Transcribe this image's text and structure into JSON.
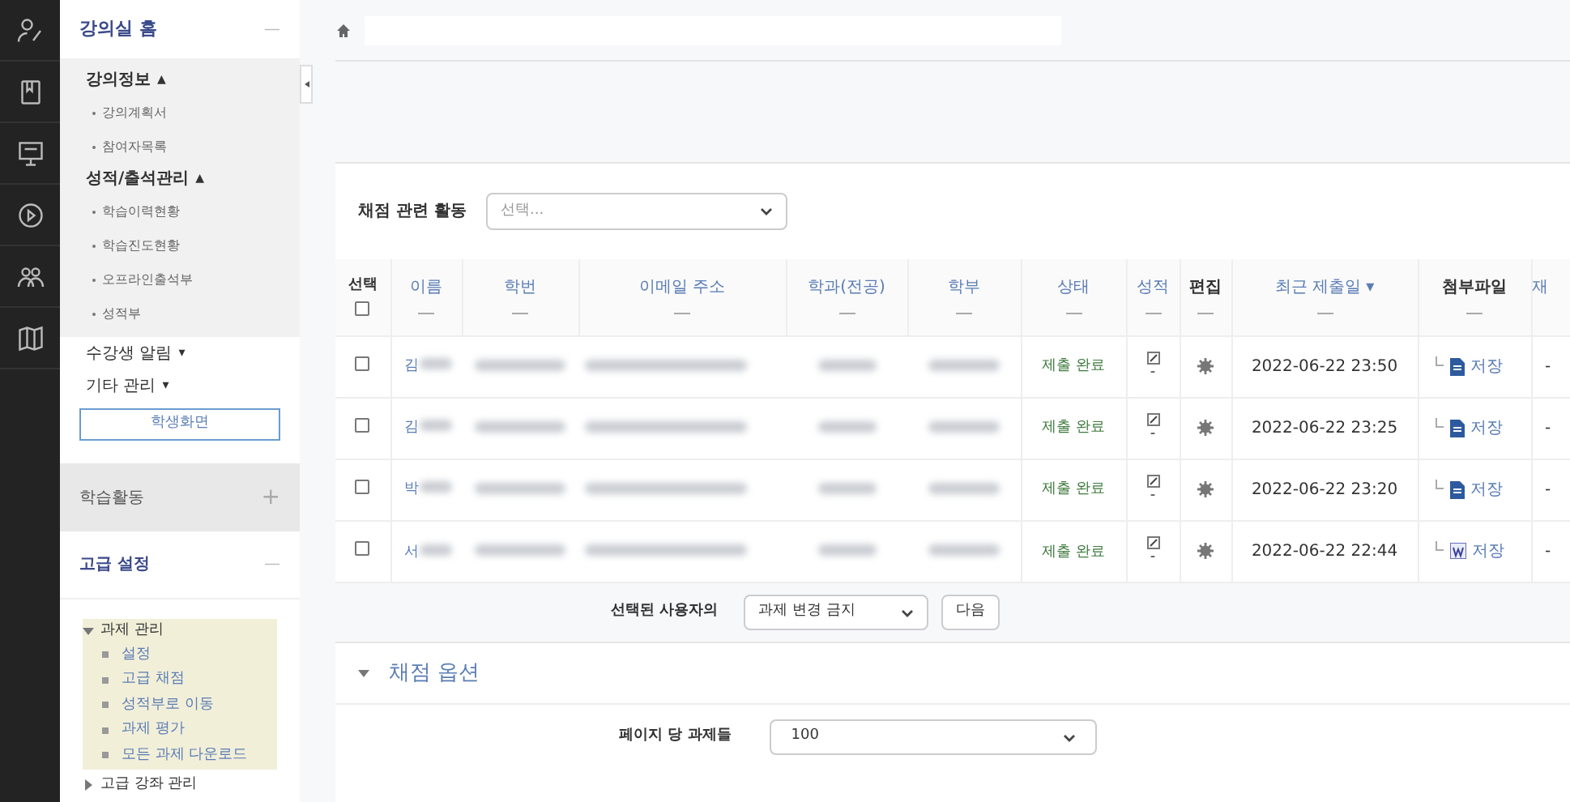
{
  "rail": {
    "items": [
      {
        "kind": "person"
      },
      {
        "kind": "book"
      },
      {
        "kind": "board"
      },
      {
        "kind": "play"
      },
      {
        "kind": "people"
      },
      {
        "kind": "map"
      }
    ]
  },
  "sidebar": {
    "home": {
      "title": "강의실 홈",
      "toggle": "—"
    },
    "groups": [
      {
        "title": "강의정보",
        "arrow": "▲",
        "children": [
          {
            "label": "강의계획서"
          },
          {
            "label": "참여자목록"
          }
        ]
      },
      {
        "title": "성적/출석관리",
        "arrow": "▲",
        "children": [
          {
            "label": "학습이력현황"
          },
          {
            "label": "학습진도현황"
          },
          {
            "label": "오프라인출석부"
          },
          {
            "label": "성적부"
          }
        ]
      }
    ],
    "menus": [
      {
        "label": "수강생 알림",
        "arrow": "▾"
      },
      {
        "label": "기타 관리",
        "arrow": "▾"
      }
    ],
    "student_view_button": "학생화면",
    "activities": {
      "title": "학습활동",
      "toggle": "+"
    },
    "advanced": {
      "title": "고급 설정",
      "toggle": "—"
    },
    "tree": [
      {
        "label": "과제 관리",
        "expanded": true,
        "children": [
          {
            "label": "설정"
          },
          {
            "label": "고급 채점"
          },
          {
            "label": "성적부로 이동"
          },
          {
            "label": "과제 평가"
          },
          {
            "label": "모든 과제 다운로드"
          }
        ]
      },
      {
        "label": "고급 강좌 관리",
        "expanded": false
      }
    ]
  },
  "main": {
    "grading_activity": {
      "label": "채점 관련 활동",
      "placeholder": "선택..."
    },
    "table": {
      "select_all_checked": false,
      "columns": [
        {
          "label": "선택",
          "kind": "check"
        },
        {
          "label": "이름",
          "kind": "link"
        },
        {
          "label": "학번",
          "kind": "link"
        },
        {
          "label": "이메일 주소",
          "kind": "link"
        },
        {
          "label": "학과(전공)",
          "kind": "link"
        },
        {
          "label": "학부",
          "kind": "link"
        },
        {
          "label": "상태",
          "kind": "link"
        },
        {
          "label": "성적",
          "kind": "link"
        },
        {
          "label": "편집",
          "kind": "plain"
        },
        {
          "label": "최근 제출일",
          "kind": "sort"
        },
        {
          "label": "첨부파일",
          "kind": "plain"
        },
        {
          "label": "재",
          "kind": "cut"
        }
      ],
      "rows": [
        {
          "checked": false,
          "name": "김",
          "status": "제출 완료",
          "grade": "-",
          "submitted": "2022-06-22 23:50",
          "file": {
            "kind": "doc",
            "label": "저장"
          },
          "last": "-"
        },
        {
          "checked": false,
          "name": "김",
          "status": "제출 완료",
          "grade": "-",
          "submitted": "2022-06-22 23:25",
          "file": {
            "kind": "doc",
            "label": "저장"
          },
          "last": "-"
        },
        {
          "checked": false,
          "name": "박",
          "status": "제출 완료",
          "grade": "-",
          "submitted": "2022-06-22 23:20",
          "file": {
            "kind": "doc",
            "label": "저장"
          },
          "last": "-"
        },
        {
          "checked": false,
          "name": "서",
          "status": "제출 완료",
          "grade": "-",
          "submitted": "2022-06-22 22:44",
          "file": {
            "kind": "word",
            "label": "저장"
          },
          "last": "-"
        }
      ]
    },
    "bulk": {
      "label": "선택된 사용자의",
      "value": "과제 변경 금지",
      "button": "다음"
    },
    "options": {
      "title": "채점 옵션",
      "expanded": true,
      "per_page_label": "페이지 당 과제들",
      "per_page": "100"
    }
  }
}
